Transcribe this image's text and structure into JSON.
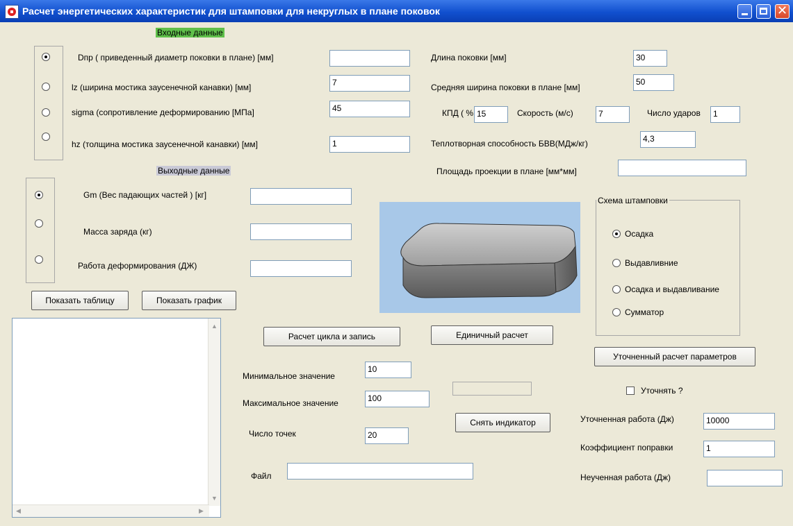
{
  "window": {
    "title": "Расчет энергетических характеристик для штамповки для некруглых в плане поковок",
    "close_glyph": "✕"
  },
  "input_section": {
    "heading": "Входные данные",
    "dpr_label": "Dпр ( приведенный диаметр поковки в плане)  [мм]",
    "dpr_value": "",
    "lz_label": "lz (ширина мостика заусенечной канавки)     [мм]",
    "lz_value": "7",
    "sigma_label": "sigma (сопротивление деформированию     [МПа]",
    "sigma_value": "45",
    "hz_label": "hz (толщина мостика заусенечной канавки) [мм]",
    "hz_value": "1",
    "length_label": "Длина поковки [мм]",
    "length_value": "30",
    "width_label": "Средняя ширина поковки в плане [мм]",
    "width_value": "50",
    "kpd_label": "КПД ( % )",
    "kpd_value": "15",
    "speed_label": "Скорость (м/с)",
    "speed_value": "7",
    "hits_label": "Число ударов",
    "hits_value": "1",
    "heat_label": "Теплотворная способность БВВ(МДж/кг)",
    "heat_value": "4,3",
    "area_label": "Площадь проекции в плане [мм*мм]",
    "area_value": ""
  },
  "output_section": {
    "heading": "Выходные данные",
    "gm_label": "Gm (Вес падающих частей  )   [кг]",
    "gm_value": "",
    "charge_label": "Масса заряда (кг)",
    "charge_value": "",
    "work_label": "Работа деформирования (ДЖ)",
    "work_value": ""
  },
  "buttons": {
    "show_table": "Показать таблицу",
    "show_graph": "Показать график",
    "cycle_calc": "Расчет цикла и запись",
    "single_calc": "Единичный расчет",
    "refined_calc": "Уточненный расчет параметров",
    "reset_indicator": "Снять индикатор"
  },
  "scheme": {
    "title": "Схема штамповки",
    "options": [
      "Осадка",
      "Выдавливние",
      "Осадка и выдавливание",
      "Сумматор"
    ]
  },
  "cycle": {
    "min_label": "Минимальное значение",
    "min_value": "10",
    "max_label": "Максимальное значение",
    "max_value": "100",
    "points_label": "Число точек",
    "points_value": "20",
    "file_label": "Файл",
    "file_value": ""
  },
  "refine": {
    "checkbox_label": "Уточнять ?",
    "refined_work_label": "Уточненная работа (Дж)",
    "refined_work_value": "10000",
    "coef_label": "Коэффициент поправки",
    "coef_value": "1",
    "unrefined_work_label": "Неученная работа (Дж)",
    "unrefined_work_value": ""
  },
  "colors": {
    "title_bar": "#1150cf",
    "input_heading_bg": "#5fbf4a",
    "preview_bg": "#a8c8e8",
    "form_bg": "#ece9d8"
  }
}
